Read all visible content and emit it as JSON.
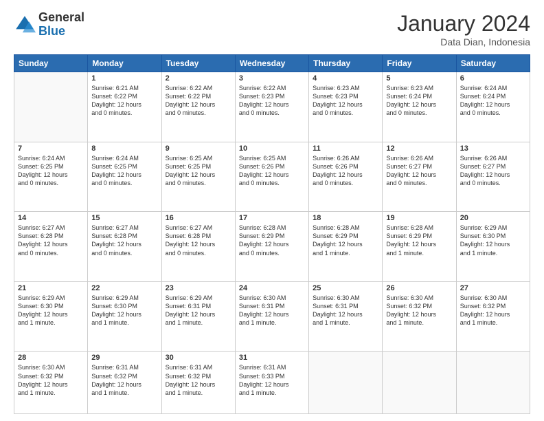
{
  "logo": {
    "general": "General",
    "blue": "Blue"
  },
  "title": {
    "month": "January 2024",
    "location": "Data Dian, Indonesia"
  },
  "weekdays": [
    "Sunday",
    "Monday",
    "Tuesday",
    "Wednesday",
    "Thursday",
    "Friday",
    "Saturday"
  ],
  "weeks": [
    [
      {
        "day": "",
        "info": ""
      },
      {
        "day": "1",
        "info": "Sunrise: 6:21 AM\nSunset: 6:22 PM\nDaylight: 12 hours\nand 0 minutes."
      },
      {
        "day": "2",
        "info": "Sunrise: 6:22 AM\nSunset: 6:22 PM\nDaylight: 12 hours\nand 0 minutes."
      },
      {
        "day": "3",
        "info": "Sunrise: 6:22 AM\nSunset: 6:23 PM\nDaylight: 12 hours\nand 0 minutes."
      },
      {
        "day": "4",
        "info": "Sunrise: 6:23 AM\nSunset: 6:23 PM\nDaylight: 12 hours\nand 0 minutes."
      },
      {
        "day": "5",
        "info": "Sunrise: 6:23 AM\nSunset: 6:24 PM\nDaylight: 12 hours\nand 0 minutes."
      },
      {
        "day": "6",
        "info": "Sunrise: 6:24 AM\nSunset: 6:24 PM\nDaylight: 12 hours\nand 0 minutes."
      }
    ],
    [
      {
        "day": "7",
        "info": "Sunrise: 6:24 AM\nSunset: 6:25 PM\nDaylight: 12 hours\nand 0 minutes."
      },
      {
        "day": "8",
        "info": "Sunrise: 6:24 AM\nSunset: 6:25 PM\nDaylight: 12 hours\nand 0 minutes."
      },
      {
        "day": "9",
        "info": "Sunrise: 6:25 AM\nSunset: 6:25 PM\nDaylight: 12 hours\nand 0 minutes."
      },
      {
        "day": "10",
        "info": "Sunrise: 6:25 AM\nSunset: 6:26 PM\nDaylight: 12 hours\nand 0 minutes."
      },
      {
        "day": "11",
        "info": "Sunrise: 6:26 AM\nSunset: 6:26 PM\nDaylight: 12 hours\nand 0 minutes."
      },
      {
        "day": "12",
        "info": "Sunrise: 6:26 AM\nSunset: 6:27 PM\nDaylight: 12 hours\nand 0 minutes."
      },
      {
        "day": "13",
        "info": "Sunrise: 6:26 AM\nSunset: 6:27 PM\nDaylight: 12 hours\nand 0 minutes."
      }
    ],
    [
      {
        "day": "14",
        "info": "Sunrise: 6:27 AM\nSunset: 6:28 PM\nDaylight: 12 hours\nand 0 minutes."
      },
      {
        "day": "15",
        "info": "Sunrise: 6:27 AM\nSunset: 6:28 PM\nDaylight: 12 hours\nand 0 minutes."
      },
      {
        "day": "16",
        "info": "Sunrise: 6:27 AM\nSunset: 6:28 PM\nDaylight: 12 hours\nand 0 minutes."
      },
      {
        "day": "17",
        "info": "Sunrise: 6:28 AM\nSunset: 6:29 PM\nDaylight: 12 hours\nand 0 minutes."
      },
      {
        "day": "18",
        "info": "Sunrise: 6:28 AM\nSunset: 6:29 PM\nDaylight: 12 hours\nand 1 minute."
      },
      {
        "day": "19",
        "info": "Sunrise: 6:28 AM\nSunset: 6:29 PM\nDaylight: 12 hours\nand 1 minute."
      },
      {
        "day": "20",
        "info": "Sunrise: 6:29 AM\nSunset: 6:30 PM\nDaylight: 12 hours\nand 1 minute."
      }
    ],
    [
      {
        "day": "21",
        "info": "Sunrise: 6:29 AM\nSunset: 6:30 PM\nDaylight: 12 hours\nand 1 minute."
      },
      {
        "day": "22",
        "info": "Sunrise: 6:29 AM\nSunset: 6:30 PM\nDaylight: 12 hours\nand 1 minute."
      },
      {
        "day": "23",
        "info": "Sunrise: 6:29 AM\nSunset: 6:31 PM\nDaylight: 12 hours\nand 1 minute."
      },
      {
        "day": "24",
        "info": "Sunrise: 6:30 AM\nSunset: 6:31 PM\nDaylight: 12 hours\nand 1 minute."
      },
      {
        "day": "25",
        "info": "Sunrise: 6:30 AM\nSunset: 6:31 PM\nDaylight: 12 hours\nand 1 minute."
      },
      {
        "day": "26",
        "info": "Sunrise: 6:30 AM\nSunset: 6:32 PM\nDaylight: 12 hours\nand 1 minute."
      },
      {
        "day": "27",
        "info": "Sunrise: 6:30 AM\nSunset: 6:32 PM\nDaylight: 12 hours\nand 1 minute."
      }
    ],
    [
      {
        "day": "28",
        "info": "Sunrise: 6:30 AM\nSunset: 6:32 PM\nDaylight: 12 hours\nand 1 minute."
      },
      {
        "day": "29",
        "info": "Sunrise: 6:31 AM\nSunset: 6:32 PM\nDaylight: 12 hours\nand 1 minute."
      },
      {
        "day": "30",
        "info": "Sunrise: 6:31 AM\nSunset: 6:32 PM\nDaylight: 12 hours\nand 1 minute."
      },
      {
        "day": "31",
        "info": "Sunrise: 6:31 AM\nSunset: 6:33 PM\nDaylight: 12 hours\nand 1 minute."
      },
      {
        "day": "",
        "info": ""
      },
      {
        "day": "",
        "info": ""
      },
      {
        "day": "",
        "info": ""
      }
    ]
  ]
}
